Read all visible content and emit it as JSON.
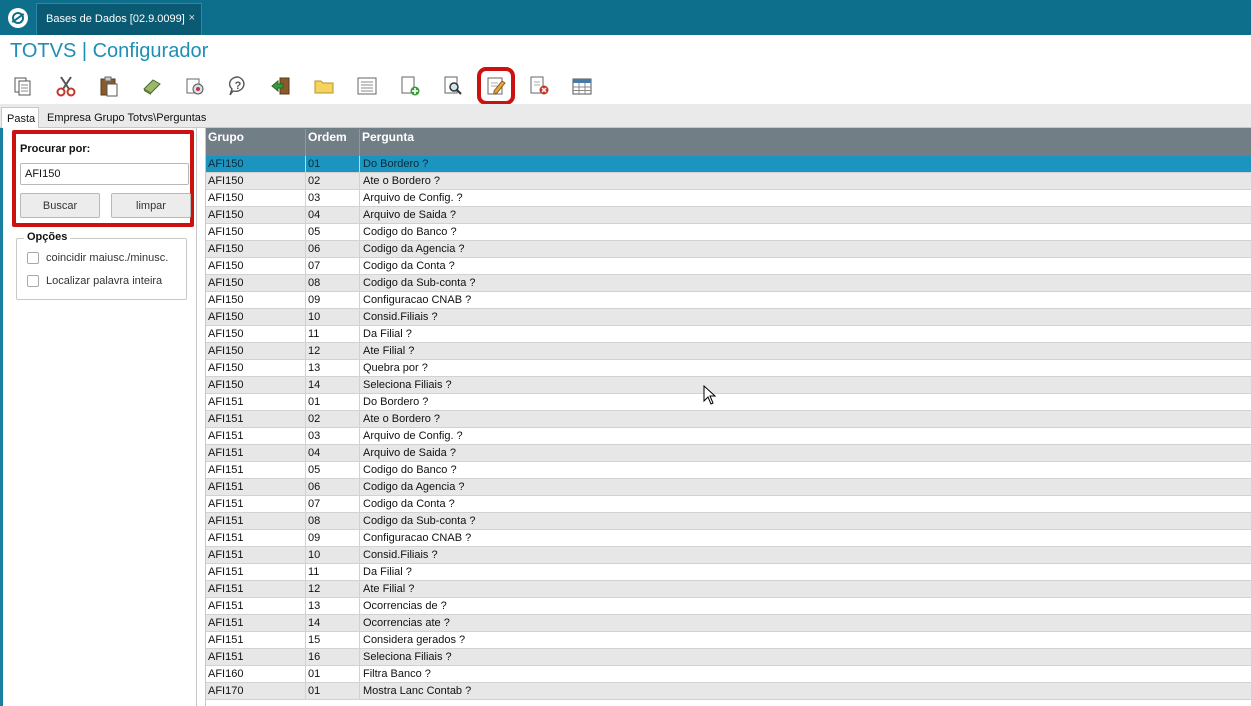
{
  "window": {
    "tab_title": "Bases de Dados [02.9.0099]",
    "tab_close": "×",
    "app_title": "TOTVS | Configurador"
  },
  "toolbar": {
    "icons": [
      "copy-icon",
      "cut-icon",
      "paste-icon",
      "eraser-icon",
      "settings-icon",
      "help-icon",
      "exit-icon",
      "folder-icon",
      "list-icon",
      "add-document-icon",
      "search-document-icon",
      "edit-document-icon",
      "delete-document-icon",
      "table-icon"
    ],
    "highlighted": "edit-document-icon",
    "highlight_color": "#cc1111"
  },
  "folder_tabs": {
    "active": "Pasta",
    "path": "Empresa Grupo Totvs\\Perguntas"
  },
  "search": {
    "label": "Procurar por:",
    "value": "AFI150",
    "buscar": "Buscar",
    "limpar": "limpar"
  },
  "options": {
    "legend": "Opções",
    "opt1": "coincidir maiusc./minusc.",
    "opt2": "Localizar palavra inteira"
  },
  "table": {
    "columns": [
      "Grupo",
      "Ordem",
      "Pergunta"
    ],
    "selected_row": 0,
    "rows": [
      [
        "AFI150",
        "01",
        "Do Bordero ?"
      ],
      [
        "AFI150",
        "02",
        "Ate o Bordero ?"
      ],
      [
        "AFI150",
        "03",
        "Arquivo de Config. ?"
      ],
      [
        "AFI150",
        "04",
        "Arquivo de Saida ?"
      ],
      [
        "AFI150",
        "05",
        "Codigo do Banco ?"
      ],
      [
        "AFI150",
        "06",
        "Codigo da Agencia ?"
      ],
      [
        "AFI150",
        "07",
        "Codigo da Conta ?"
      ],
      [
        "AFI150",
        "08",
        "Codigo da Sub-conta ?"
      ],
      [
        "AFI150",
        "09",
        "Configuracao CNAB ?"
      ],
      [
        "AFI150",
        "10",
        "Consid.Filiais ?"
      ],
      [
        "AFI150",
        "11",
        "Da Filial ?"
      ],
      [
        "AFI150",
        "12",
        "Ate Filial ?"
      ],
      [
        "AFI150",
        "13",
        "Quebra por ?"
      ],
      [
        "AFI150",
        "14",
        "Seleciona Filiais ?"
      ],
      [
        "AFI151",
        "01",
        "Do Bordero ?"
      ],
      [
        "AFI151",
        "02",
        "Ate o Bordero ?"
      ],
      [
        "AFI151",
        "03",
        "Arquivo de Config. ?"
      ],
      [
        "AFI151",
        "04",
        "Arquivo de Saida ?"
      ],
      [
        "AFI151",
        "05",
        "Codigo do Banco ?"
      ],
      [
        "AFI151",
        "06",
        "Codigo da Agencia ?"
      ],
      [
        "AFI151",
        "07",
        "Codigo da Conta ?"
      ],
      [
        "AFI151",
        "08",
        "Codigo da Sub-conta ?"
      ],
      [
        "AFI151",
        "09",
        "Configuracao CNAB ?"
      ],
      [
        "AFI151",
        "10",
        "Consid.Filiais ?"
      ],
      [
        "AFI151",
        "11",
        "Da Filial ?"
      ],
      [
        "AFI151",
        "12",
        "Ate Filial ?"
      ],
      [
        "AFI151",
        "13",
        "Ocorrencias de ?"
      ],
      [
        "AFI151",
        "14",
        "Ocorrencias ate ?"
      ],
      [
        "AFI151",
        "15",
        "Considera gerados ?"
      ],
      [
        "AFI151",
        "16",
        "Seleciona Filiais ?"
      ],
      [
        "AFI160",
        "01",
        "Filtra Banco ?"
      ],
      [
        "AFI170",
        "01",
        "Mostra Lanc Contab ?"
      ]
    ]
  },
  "colors": {
    "topbar": "#0e6f8c",
    "title": "#1d8fb5",
    "selected_row": "#1b95c0",
    "header": "#727e86"
  }
}
